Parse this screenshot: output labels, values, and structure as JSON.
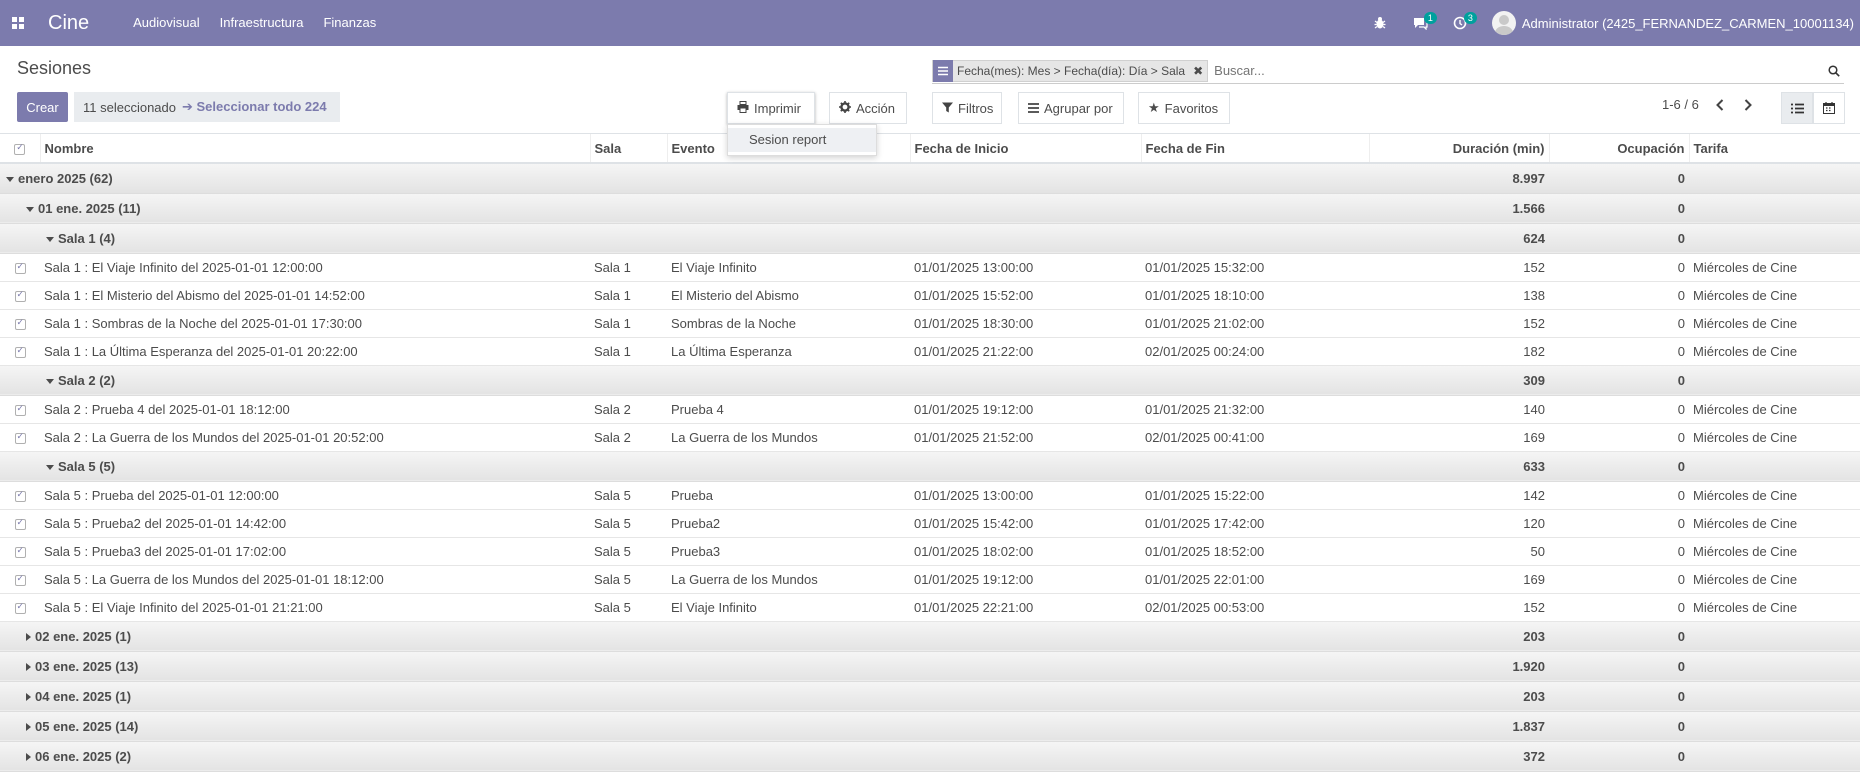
{
  "navbar": {
    "brand": "Cine",
    "menu": [
      "Audiovisual",
      "Infraestructura",
      "Finanzas"
    ],
    "messages_count": "1",
    "activities_count": "3",
    "user_name": "Administrator (2425_FERNANDEZ_CARMEN_10001134)",
    "color": "#7c7bad"
  },
  "control_panel": {
    "breadcrumb": "Sesiones",
    "search_facet": "Fecha(mes): Mes > Fecha(día): Día > Sala",
    "search_placeholder": "Buscar...",
    "create_label": "Crear",
    "selected_text": "11 seleccionado",
    "select_all_text": "Seleccionar todo 224",
    "print_label": "Imprimir",
    "action_label": "Acción",
    "filters_label": "Filtros",
    "group_by_label": "Agrupar por",
    "favorites_label": "Favoritos",
    "pager_value": "1-6 / 6"
  },
  "print_dropdown": {
    "items": [
      "Sesion report"
    ]
  },
  "columns": [
    "Nombre",
    "Sala",
    "Evento",
    "Fecha de Inicio",
    "Fecha de Fin",
    "Duración (min)",
    "Ocupación",
    "Tarifa"
  ],
  "rows": [
    {
      "type": "group",
      "level": 0,
      "open": true,
      "label": "enero 2025 (62)",
      "duration": "8.997",
      "occupancy": "0"
    },
    {
      "type": "group",
      "level": 1,
      "open": true,
      "label": "01 ene. 2025 (11)",
      "duration": "1.566",
      "occupancy": "0"
    },
    {
      "type": "group",
      "level": 2,
      "open": true,
      "label": "Sala 1 (4)",
      "duration": "624",
      "occupancy": "0"
    },
    {
      "type": "rec",
      "name": "Sala 1 : El Viaje Infinito del 2025-01-01 12:00:00",
      "sala": "Sala 1",
      "evento": "El Viaje Infinito",
      "inicio": "01/01/2025 13:00:00",
      "fin": "01/01/2025 15:32:00",
      "duration": "152",
      "occupancy": "0",
      "tarifa": "Miércoles de Cine"
    },
    {
      "type": "rec",
      "name": "Sala 1 : El Misterio del Abismo del 2025-01-01 14:52:00",
      "sala": "Sala 1",
      "evento": "El Misterio del Abismo",
      "inicio": "01/01/2025 15:52:00",
      "fin": "01/01/2025 18:10:00",
      "duration": "138",
      "occupancy": "0",
      "tarifa": "Miércoles de Cine"
    },
    {
      "type": "rec",
      "name": "Sala 1 : Sombras de la Noche del 2025-01-01 17:30:00",
      "sala": "Sala 1",
      "evento": "Sombras de la Noche",
      "inicio": "01/01/2025 18:30:00",
      "fin": "01/01/2025 21:02:00",
      "duration": "152",
      "occupancy": "0",
      "tarifa": "Miércoles de Cine"
    },
    {
      "type": "rec",
      "name": "Sala 1 : La Última Esperanza del 2025-01-01 20:22:00",
      "sala": "Sala 1",
      "evento": "La Última Esperanza",
      "inicio": "01/01/2025 21:22:00",
      "fin": "02/01/2025 00:24:00",
      "duration": "182",
      "occupancy": "0",
      "tarifa": "Miércoles de Cine"
    },
    {
      "type": "group",
      "level": 2,
      "open": true,
      "label": "Sala 2 (2)",
      "duration": "309",
      "occupancy": "0"
    },
    {
      "type": "rec",
      "name": "Sala 2 : Prueba 4 del 2025-01-01 18:12:00",
      "sala": "Sala 2",
      "evento": "Prueba 4",
      "inicio": "01/01/2025 19:12:00",
      "fin": "01/01/2025 21:32:00",
      "duration": "140",
      "occupancy": "0",
      "tarifa": "Miércoles de Cine"
    },
    {
      "type": "rec",
      "name": "Sala 2 : La Guerra de los Mundos del 2025-01-01 20:52:00",
      "sala": "Sala 2",
      "evento": "La Guerra de los Mundos",
      "inicio": "01/01/2025 21:52:00",
      "fin": "02/01/2025 00:41:00",
      "duration": "169",
      "occupancy": "0",
      "tarifa": "Miércoles de Cine"
    },
    {
      "type": "group",
      "level": 2,
      "open": true,
      "label": "Sala 5 (5)",
      "duration": "633",
      "occupancy": "0"
    },
    {
      "type": "rec",
      "name": "Sala 5 : Prueba del 2025-01-01 12:00:00",
      "sala": "Sala 5",
      "evento": "Prueba",
      "inicio": "01/01/2025 13:00:00",
      "fin": "01/01/2025 15:22:00",
      "duration": "142",
      "occupancy": "0",
      "tarifa": "Miércoles de Cine"
    },
    {
      "type": "rec",
      "name": "Sala 5 : Prueba2 del 2025-01-01 14:42:00",
      "sala": "Sala 5",
      "evento": "Prueba2",
      "inicio": "01/01/2025 15:42:00",
      "fin": "01/01/2025 17:42:00",
      "duration": "120",
      "occupancy": "0",
      "tarifa": "Miércoles de Cine"
    },
    {
      "type": "rec",
      "name": "Sala 5 : Prueba3 del 2025-01-01 17:02:00",
      "sala": "Sala 5",
      "evento": "Prueba3",
      "inicio": "01/01/2025 18:02:00",
      "fin": "01/01/2025 18:52:00",
      "duration": "50",
      "occupancy": "0",
      "tarifa": "Miércoles de Cine"
    },
    {
      "type": "rec",
      "name": "Sala 5 : La Guerra de los Mundos del 2025-01-01 18:12:00",
      "sala": "Sala 5",
      "evento": "La Guerra de los Mundos",
      "inicio": "01/01/2025 19:12:00",
      "fin": "01/01/2025 22:01:00",
      "duration": "169",
      "occupancy": "0",
      "tarifa": "Miércoles de Cine"
    },
    {
      "type": "rec",
      "name": "Sala 5 : El Viaje Infinito del 2025-01-01 21:21:00",
      "sala": "Sala 5",
      "evento": "El Viaje Infinito",
      "inicio": "01/01/2025 22:21:00",
      "fin": "02/01/2025 00:53:00",
      "duration": "152",
      "occupancy": "0",
      "tarifa": "Miércoles de Cine"
    },
    {
      "type": "group",
      "level": 1,
      "open": false,
      "label": "02 ene. 2025 (1)",
      "duration": "203",
      "occupancy": "0"
    },
    {
      "type": "group",
      "level": 1,
      "open": false,
      "label": "03 ene. 2025 (13)",
      "duration": "1.920",
      "occupancy": "0"
    },
    {
      "type": "group",
      "level": 1,
      "open": false,
      "label": "04 ene. 2025 (1)",
      "duration": "203",
      "occupancy": "0"
    },
    {
      "type": "group",
      "level": 1,
      "open": false,
      "label": "05 ene. 2025 (14)",
      "duration": "1.837",
      "occupancy": "0"
    },
    {
      "type": "group",
      "level": 1,
      "open": false,
      "label": "06 ene. 2025 (2)",
      "duration": "372",
      "occupancy": "0"
    }
  ]
}
